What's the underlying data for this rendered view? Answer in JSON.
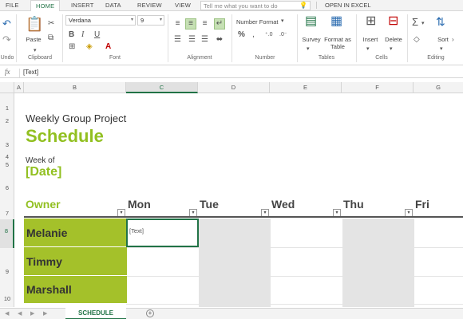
{
  "ribbon_tabs": [
    "FILE",
    "HOME",
    "INSERT",
    "DATA",
    "REVIEW",
    "VIEW"
  ],
  "tell_me": {
    "placeholder": "Tell me what you want to do"
  },
  "open_in_excel": "OPEN IN EXCEL",
  "groups": {
    "undo": "Undo",
    "clipboard": "Clipboard",
    "font": "Font",
    "alignment": "Alignment",
    "number": "Number",
    "tables": "Tables",
    "cells": "Cells",
    "editing": "Editing"
  },
  "buttons": {
    "paste": "Paste",
    "survey": "Survey",
    "format_table": "Format as Table",
    "insert": "Insert",
    "delete": "Delete",
    "sort": "Sort"
  },
  "font": {
    "name": "Verdana",
    "size": "9"
  },
  "number_format": "Number Format",
  "formula_bar": {
    "fx": "fx",
    "value": "[Text]"
  },
  "columns": [
    "A",
    "B",
    "C",
    "D",
    "E",
    "F",
    "G"
  ],
  "rows": [
    "1",
    "2",
    "3",
    "4",
    "5",
    "6",
    "7",
    "8",
    "9",
    "10"
  ],
  "sheet": {
    "subtitle": "Weekly Group Project",
    "title": "Schedule",
    "week_of": "Week of",
    "date": "[Date]",
    "headers": [
      "Owner",
      "Mon",
      "Tue",
      "Wed",
      "Thu",
      "Fri"
    ],
    "owners": [
      "Melanie",
      "Timmy",
      "Marshall"
    ],
    "active_cell_text": "[Text]"
  },
  "sheet_tab": "SCHEDULE",
  "colors": {
    "accent": "#92c021",
    "owner_fill": "#a4c12a",
    "excel_green": "#217346"
  }
}
